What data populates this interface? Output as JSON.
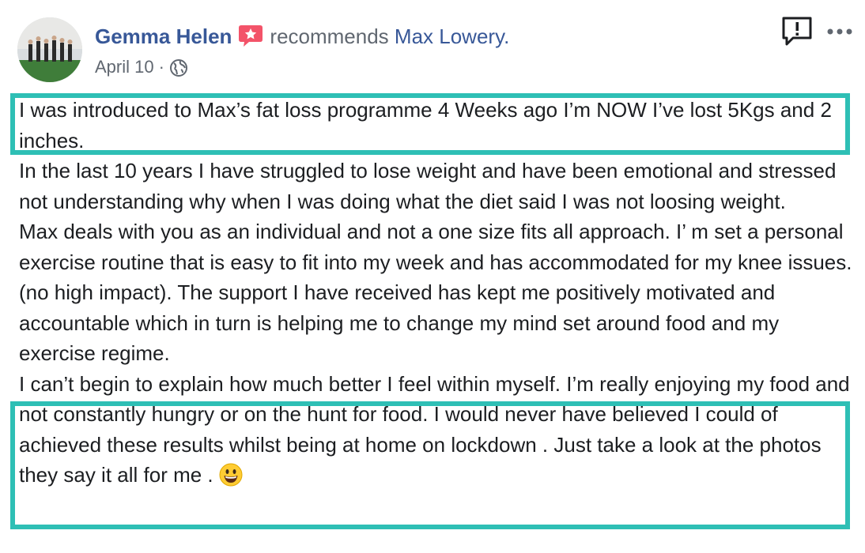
{
  "post": {
    "author": "Gemma Helen",
    "action": "recommends",
    "page_name": "Max Lowery.",
    "date": "April 10",
    "separator": "·",
    "privacy_icon": "globe-icon",
    "report_icon": "report-icon",
    "more_icon": "more-options-icon",
    "badge_icon": "recommendation-star-icon",
    "emoji_icon": "grinning-face-emoji",
    "paragraphs": [
      "I was introduced to Max’s fat loss programme 4 Weeks ago I’m NOW I’ve lost 5Kgs and 2 inches.",
      "In the last 10 years I have struggled to lose weight and have been emotional and stressed not understanding why when I was doing what the diet said I was not loosing weight.",
      "Max deals with you as an individual and not a one size fits all approach. I’ m set a personal exercise routine that is easy to fit into my week and has accommodated for my knee issues.(no high impact). The support I have received has kept me positively motivated and accountable which in turn is helping me to change my mind set around food and my exercise regime.",
      "I can’t begin to explain how much better I feel within myself. I’m really enjoying my food and not constantly hungry or on the hunt for food. I would never have believed I could of achieved these results whilst being at home on lockdown . Just take a look at the photos they say it all for me ."
    ]
  },
  "colors": {
    "link": "#385898",
    "secondary_text": "#606770",
    "highlight_border": "#2ebfb5",
    "badge": "#f35369"
  }
}
